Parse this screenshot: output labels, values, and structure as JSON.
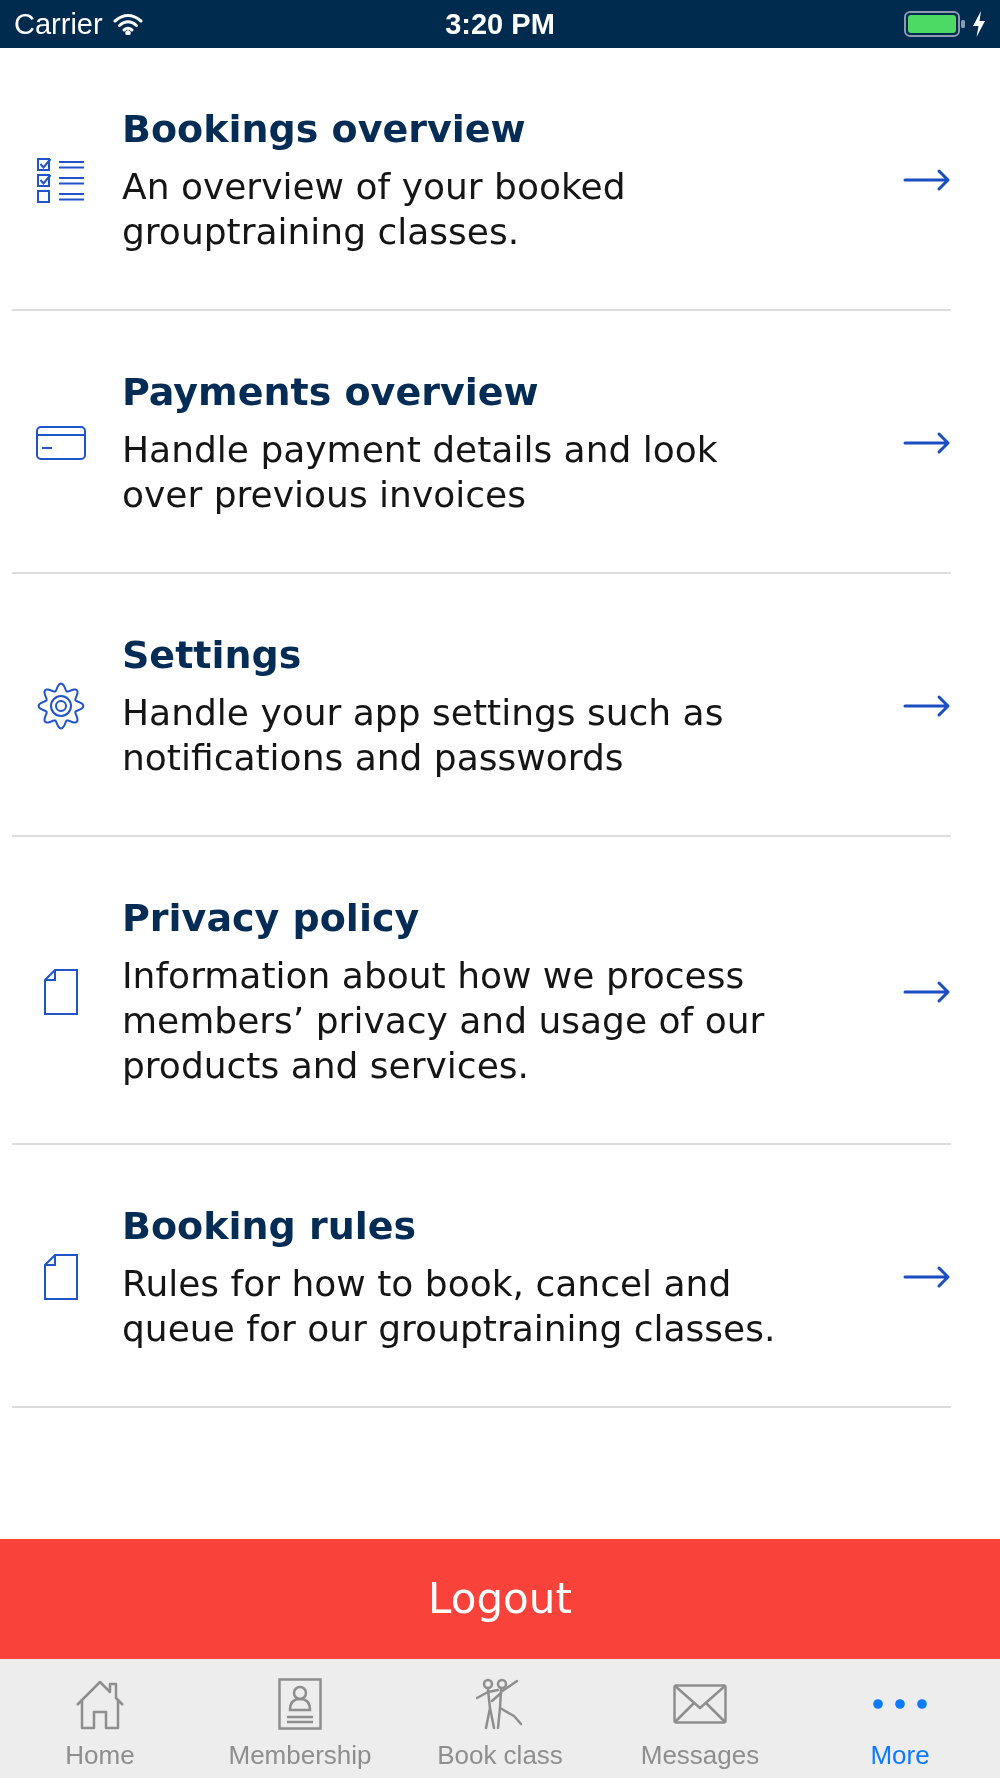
{
  "status_bar": {
    "carrier": "Carrier",
    "time": "3:20 PM"
  },
  "menu_items": [
    {
      "kind": "bookings",
      "title": "Bookings overview",
      "description": "An overview of your booked grouptraining classes."
    },
    {
      "kind": "payments",
      "title": "Payments overview",
      "description": "Handle payment details and look over previous invoices"
    },
    {
      "kind": "settings",
      "title": "Settings",
      "description": "Handle your app settings such as notifications and passwords"
    },
    {
      "kind": "document",
      "title": "Privacy policy",
      "description": "Information about how we process members’ privacy and usage of our products and services."
    },
    {
      "kind": "document",
      "title": "Booking rules",
      "description": "Rules for how to book, cancel and queue for our grouptraining classes."
    }
  ],
  "logout_button": {
    "label": "Logout"
  },
  "tab_bar": {
    "tabs": [
      {
        "kind": "home",
        "label": "Home",
        "selected": false
      },
      {
        "kind": "membership",
        "label": "Membership",
        "selected": false
      },
      {
        "kind": "booking",
        "label": "Book class",
        "selected": false
      },
      {
        "kind": "messages",
        "label": "Messages",
        "selected": false
      },
      {
        "kind": "more",
        "label": "More",
        "selected": true
      }
    ]
  }
}
